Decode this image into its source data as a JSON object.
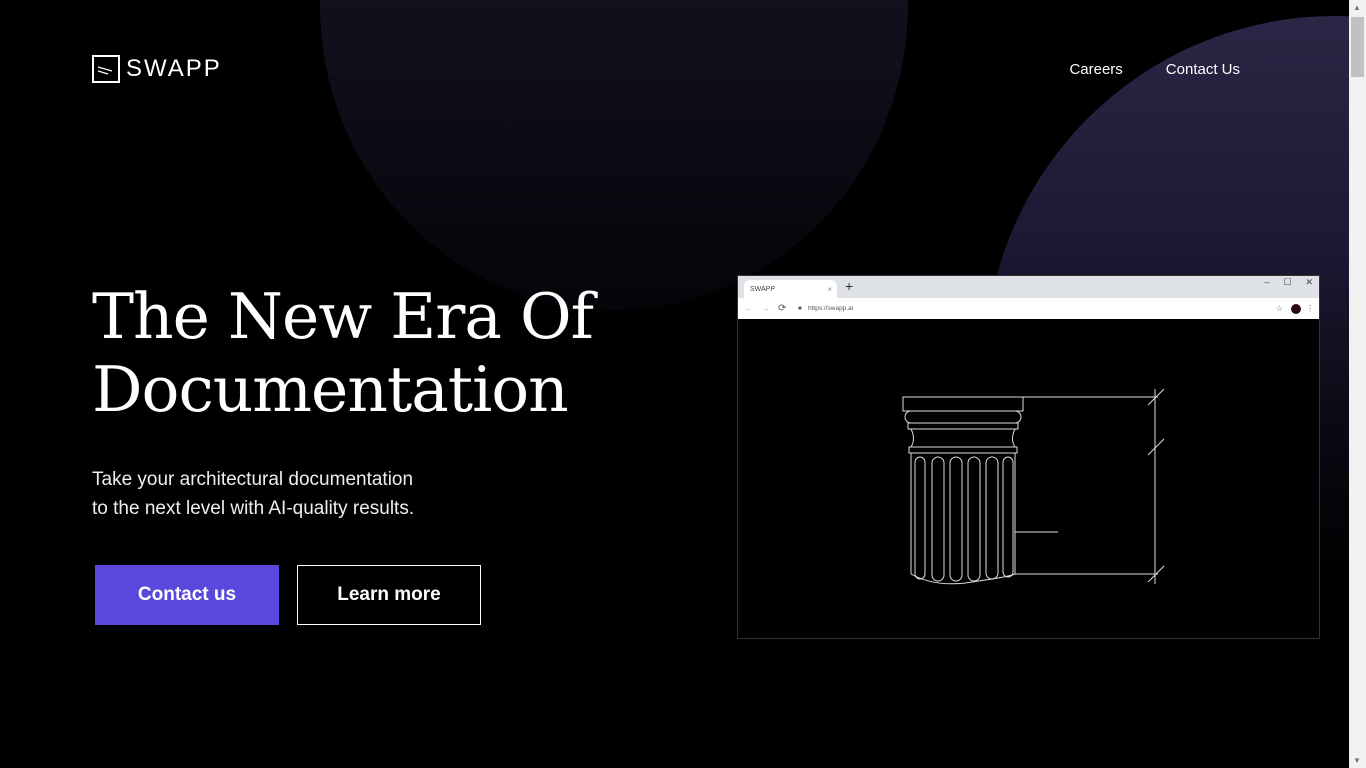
{
  "brand": {
    "name": "SWAPP",
    "accent": "#5a47dc"
  },
  "nav": {
    "items": [
      {
        "label": "Careers"
      },
      {
        "label": "Contact Us"
      }
    ]
  },
  "hero": {
    "title_line1": "The New Era Of",
    "title_line2": "Documentation",
    "subtitle_line1": "Take your architectural documentation",
    "subtitle_line2": "to the next level with AI-quality results.",
    "primary_button": "Contact us",
    "secondary_button": "Learn more"
  },
  "browser_mock": {
    "tab_title": "SWAPP",
    "tab_close": "×",
    "new_tab": "+",
    "url": "https://swapp.ai",
    "minimize": "–",
    "maximize": "☐",
    "close": "✕",
    "back": "←",
    "forward": "→",
    "reload": "⟳",
    "star": "☆",
    "menu": "⋮"
  },
  "scrollbar": {
    "up": "▲",
    "down": "▼"
  }
}
